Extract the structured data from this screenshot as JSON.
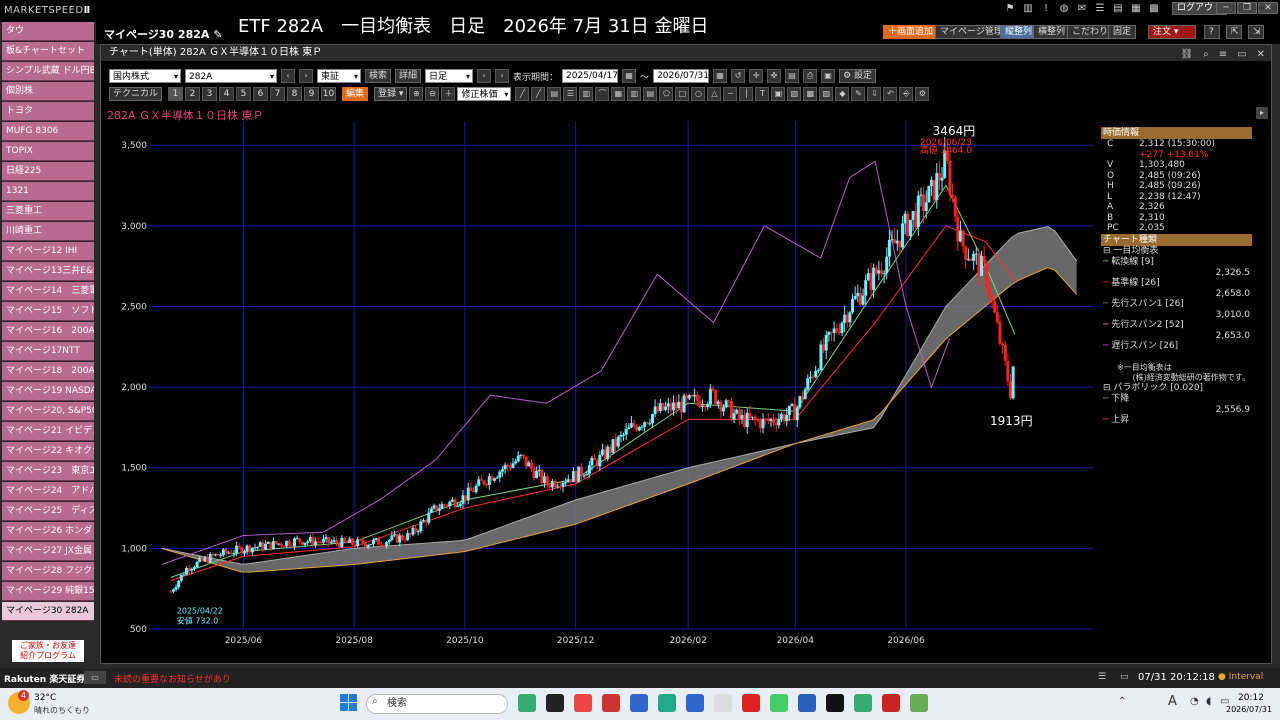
{
  "app": {
    "logo_prefix": "MARKETSPEED",
    "logo_suffix": "Ⅱ",
    "page_name": "マイページ30 282A",
    "headline": "ETF 282A　一目均衡表　日足　2026年 7月 31日 金曜日",
    "logout": "ログアウト"
  },
  "header_buttons": {
    "add_screen": "＋画面追加",
    "mypage_manage": "マイページ管理",
    "vertical": "縦整列",
    "horizontal": "横整列",
    "kodawari": "こだわり",
    "fix": "固定",
    "order": "注文"
  },
  "sidebar": {
    "items": [
      "タウ",
      "板&チャートセット",
      "シンプル武蔵 ドル円Bid",
      "個別株",
      "トヨタ",
      "MUFG 8306",
      "TOPIX",
      "日経225",
      "1321",
      "三菱重工",
      "川崎重工",
      "マイページ12 IHI",
      "マイページ13三井E&S",
      "マイページ14　三菱電",
      "マイページ15　ソフトバ",
      "マイページ16　200A",
      "マイページ17NTT",
      "マイページ18　200A",
      "マイページ19 NASDA",
      "マイページ20, S&P50",
      "マイページ21 イビデン",
      "マイページ22 キオクシ",
      "マイページ23　東京エレ",
      "マイページ24　アドバン",
      "マイページ25　ディスコ",
      "マイページ26 ホンダ",
      "マイページ27 JX金属",
      "マイページ28 フジクラ",
      "マイページ29 純銀15",
      "マイページ30 282A"
    ],
    "promo_line1": "ご家族・お友達",
    "promo_line2": "紹介プログラム"
  },
  "chart_window": {
    "title": "チャート(単体) 282A ＧＸ半導体１０日株 東Ｐ",
    "market": "国内株式",
    "code": "282A",
    "exchange": "東証",
    "search": "検索",
    "detail": "詳細",
    "period_type": "日足",
    "display_period_label": "表示期間：",
    "start_date": "2025/04/17",
    "tilde": "～",
    "end_date": "2026/07/31",
    "settings": "設定",
    "technical": "テクニカル",
    "numbers": [
      "1",
      "2",
      "3",
      "4",
      "5",
      "6",
      "7",
      "8",
      "9",
      "10"
    ],
    "edit": "編集",
    "register": "登録",
    "adjusted": "修正株価",
    "symbol_title": "282A ＧＸ半導体１０日株 東Ｐ"
  },
  "price_panel": {
    "header": "時価情報",
    "rows": [
      {
        "k": "C",
        "v": "2,312 (15:30:00)"
      },
      {
        "k": "",
        "v": "+277  +13.61%"
      },
      {
        "k": "V",
        "v": "1,303,480"
      },
      {
        "k": "O",
        "v": "2,485 (09:26)"
      },
      {
        "k": "H",
        "v": "2,485 (09:26)"
      },
      {
        "k": "L",
        "v": "2,238 (12:47)"
      },
      {
        "k": "A",
        "v": "2,326"
      },
      {
        "k": "B",
        "v": "2,310"
      },
      {
        "k": "PC",
        "v": "2,035"
      }
    ],
    "chart_type_header": "チャート種類",
    "ichimoku": "一目均衡表",
    "indicators": [
      {
        "name": "転換線 [9]",
        "value": "2,326.5",
        "color": "#7fd07f"
      },
      {
        "name": "基準線 [26]",
        "value": "2,658.0",
        "color": "#ff3030"
      },
      {
        "name": "先行スパン1 [26]",
        "value": "3,010.0",
        "color": "#888888"
      },
      {
        "name": "先行スパン2 [52]",
        "value": "2,653.0",
        "color": "#e8a33a"
      },
      {
        "name": "遅行スパン [26]",
        "value": "",
        "color": "#b85cc8"
      }
    ],
    "note1": "※一目均衡表は",
    "note2": "(株)経済変動総研の著作物です。",
    "parabolic": "パラボリック [0.020]",
    "down": "下降",
    "down_value": "2,556.9",
    "up": "上昇"
  },
  "statusbar": {
    "brand": "Rakuten 楽天証券",
    "notice": "未読の重要なお知らせがあり",
    "datetime": "07/31 20:12:18",
    "interval": "Interval"
  },
  "taskbar": {
    "weather_badge": "4",
    "temp": "32°C",
    "weather": "晴れのちくもり",
    "search": "検索",
    "ime": "A",
    "time": "20:12",
    "date": "2026/07/31"
  },
  "chart_data": {
    "type": "candlestick",
    "title": "",
    "xlabel": "",
    "ylabel": "",
    "ylim": [
      500,
      3650
    ],
    "yticks": [
      500,
      1000,
      1500,
      2000,
      2500,
      3000,
      3500
    ],
    "ytick_labels": [
      "500",
      "1,000",
      "1,500",
      "2,000",
      "2,500",
      "3,000",
      "3,500"
    ],
    "xticks": [
      "2025/06",
      "2025/08",
      "2025/10",
      "2025/12",
      "2026/02",
      "2026/04",
      "2026/06"
    ],
    "grid": true,
    "annotations": [
      {
        "text": "3464円",
        "date": "2026/06/23",
        "value": 3464
      },
      {
        "text": "2026/06/23",
        "date": "2026/06/23",
        "value": 3464
      },
      {
        "text": "高値 3464.0",
        "date": "2026/06/23",
        "value": 3464
      },
      {
        "text": "1913円",
        "date": "2026/07/29",
        "value": 1913
      },
      {
        "text": "2025/04/22",
        "date": "2025/04/22",
        "value": 732
      },
      {
        "text": "安値 732.0",
        "date": "2025/04/22",
        "value": 732
      }
    ],
    "series": [
      {
        "name": "ローソク足",
        "points": [
          [
            "2025/04/22",
            732
          ],
          [
            "2025/05/01",
            880
          ],
          [
            "2025/05/15",
            950
          ],
          [
            "2025/06/01",
            1000
          ],
          [
            "2025/06/15",
            1020
          ],
          [
            "2025/07/01",
            1050
          ],
          [
            "2025/07/15",
            1040
          ],
          [
            "2025/08/01",
            1030
          ],
          [
            "2025/08/15",
            1040
          ],
          [
            "2025/09/01",
            1080
          ],
          [
            "2025/09/15",
            1250
          ],
          [
            "2025/10/01",
            1320
          ],
          [
            "2025/10/15",
            1450
          ],
          [
            "2025/11/01",
            1560
          ],
          [
            "2025/11/15",
            1400
          ],
          [
            "2025/12/01",
            1450
          ],
          [
            "2025/12/15",
            1560
          ],
          [
            "2026/01/01",
            1750
          ],
          [
            "2026/01/15",
            1850
          ],
          [
            "2026/02/01",
            1900
          ],
          [
            "2026/02/15",
            1950
          ],
          [
            "2026/03/01",
            1800
          ],
          [
            "2026/03/15",
            1780
          ],
          [
            "2026/04/01",
            1850
          ],
          [
            "2026/04/15",
            2200
          ],
          [
            "2026/05/01",
            2500
          ],
          [
            "2026/05/15",
            2700
          ],
          [
            "2026/06/01",
            3000
          ],
          [
            "2026/06/15",
            3200
          ],
          [
            "2026/06/23",
            3400
          ],
          [
            "2026/07/01",
            2900
          ],
          [
            "2026/07/15",
            2700
          ],
          [
            "2026/07/29",
            1950
          ],
          [
            "2026/07/31",
            2312
          ]
        ]
      },
      {
        "name": "転換線",
        "points": [
          [
            "2025/04/22",
            820
          ],
          [
            "2025/06/01",
            980
          ],
          [
            "2025/08/01",
            1040
          ],
          [
            "2025/10/01",
            1300
          ],
          [
            "2025/12/01",
            1430
          ],
          [
            "2026/02/01",
            1900
          ],
          [
            "2026/04/01",
            1850
          ],
          [
            "2026/05/15",
            2600
          ],
          [
            "2026/06/23",
            3250
          ],
          [
            "2026/07/15",
            2750
          ],
          [
            "2026/07/31",
            2326
          ]
        ]
      },
      {
        "name": "基準線",
        "points": [
          [
            "2025/04/22",
            800
          ],
          [
            "2025/06/01",
            950
          ],
          [
            "2025/08/01",
            1010
          ],
          [
            "2025/10/01",
            1250
          ],
          [
            "2025/12/01",
            1400
          ],
          [
            "2026/02/01",
            1800
          ],
          [
            "2026/04/01",
            1800
          ],
          [
            "2026/05/15",
            2400
          ],
          [
            "2026/06/23",
            3000
          ],
          [
            "2026/07/15",
            2900
          ],
          [
            "2026/07/31",
            2658
          ]
        ]
      },
      {
        "name": "先行スパン1",
        "points": [
          [
            "2025/04/17",
            1000
          ],
          [
            "2025/06/01",
            900
          ],
          [
            "2025/08/01",
            1000
          ],
          [
            "2025/10/01",
            1050
          ],
          [
            "2025/12/01",
            1300
          ],
          [
            "2026/02/01",
            1500
          ],
          [
            "2026/04/01",
            1650
          ],
          [
            "2026/05/15",
            1750
          ],
          [
            "2026/06/23",
            2500
          ],
          [
            "2026/07/31",
            2950
          ],
          [
            "2026/08/20",
            3000
          ],
          [
            "2026/09/05",
            2750
          ]
        ]
      },
      {
        "name": "先行スパン2",
        "points": [
          [
            "2025/04/17",
            1000
          ],
          [
            "2025/06/01",
            850
          ],
          [
            "2025/08/01",
            900
          ],
          [
            "2025/10/01",
            980
          ],
          [
            "2025/12/01",
            1150
          ],
          [
            "2026/02/01",
            1400
          ],
          [
            "2026/04/01",
            1650
          ],
          [
            "2026/05/15",
            1800
          ],
          [
            "2026/06/23",
            2300
          ],
          [
            "2026/07/31",
            2653
          ],
          [
            "2026/08/20",
            2750
          ],
          [
            "2026/09/05",
            2550
          ]
        ]
      },
      {
        "name": "遅行スパン",
        "points": [
          [
            "2025/04/17",
            900
          ],
          [
            "2025/06/01",
            1080
          ],
          [
            "2025/07/15",
            1100
          ],
          [
            "2025/08/15",
            1300
          ],
          [
            "2025/09/15",
            1550
          ],
          [
            "2025/10/15",
            1950
          ],
          [
            "2025/11/15",
            1900
          ],
          [
            "2025/12/15",
            2100
          ],
          [
            "2026/01/15",
            2700
          ],
          [
            "2026/02/15",
            2400
          ],
          [
            "2026/03/15",
            3000
          ],
          [
            "2026/04/15",
            2800
          ],
          [
            "2026/05/01",
            3300
          ],
          [
            "2026/05/15",
            3400
          ],
          [
            "2026/06/01",
            2500
          ],
          [
            "2026/06/15",
            2000
          ],
          [
            "2026/06/25",
            2300
          ]
        ]
      }
    ]
  },
  "colors": {
    "accent_orange": "#e06b1a",
    "sidebar_pink": "#b66b8f",
    "grid_blue": "#1a1aa0",
    "candle_up": "#6ff0ff",
    "candle_down": "#ff2020"
  }
}
